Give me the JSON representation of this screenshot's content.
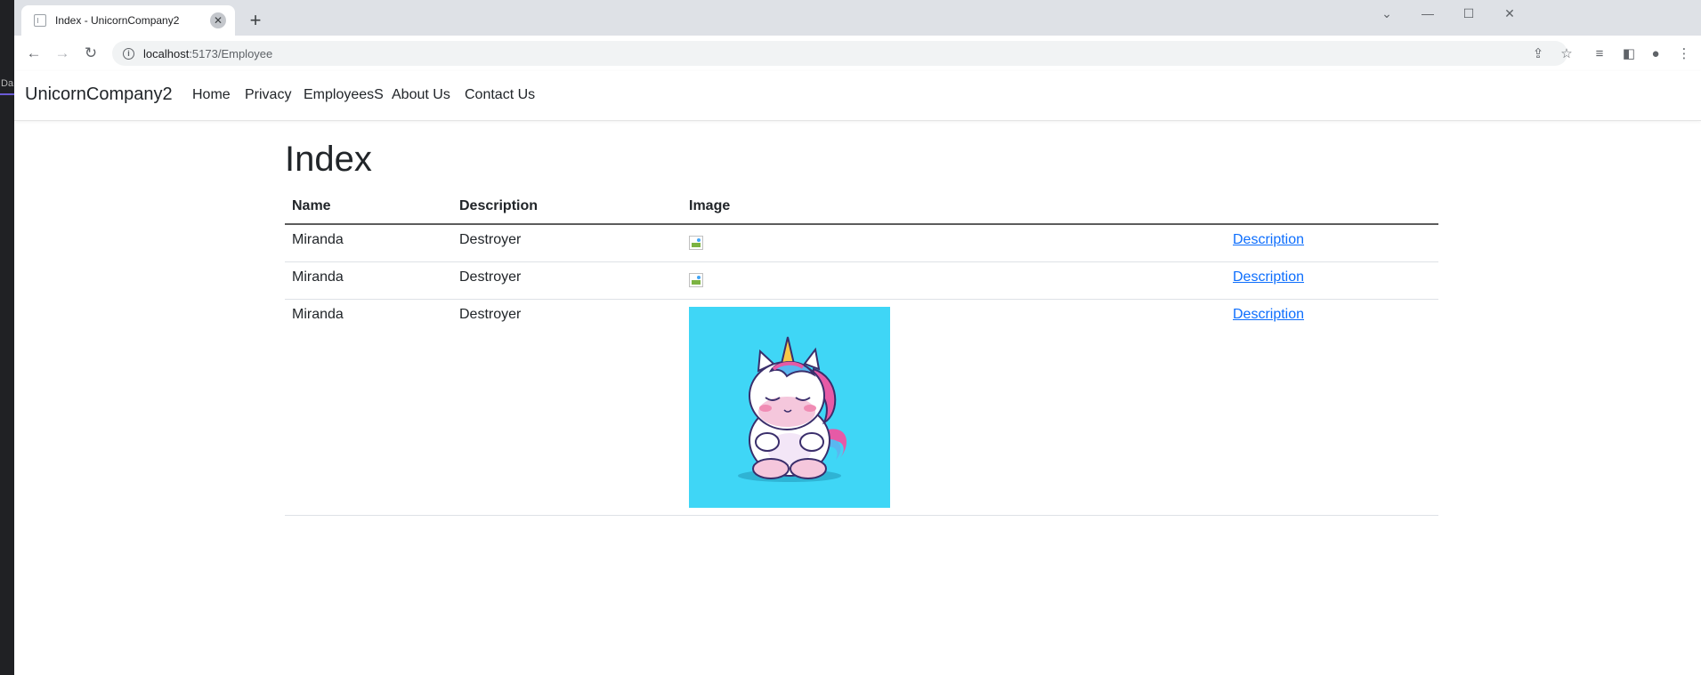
{
  "browser": {
    "tab_title": "Index - UnicornCompany2",
    "tab_close": "✕",
    "new_tab": "+",
    "url_host": "localhost",
    "url_path": ":5173/Employee",
    "left_strip_label": "Da"
  },
  "navbar": {
    "brand": "UnicornCompany2",
    "links": [
      "Home",
      "Privacy",
      "EmployeesS",
      "About Us",
      "Contact Us"
    ]
  },
  "page": {
    "title": "Index"
  },
  "table": {
    "columns": [
      "Name",
      "Description",
      "Image",
      ""
    ],
    "rows": [
      {
        "name": "Miranda",
        "description": "Destroyer",
        "image": "broken",
        "link": "Description"
      },
      {
        "name": "Miranda",
        "description": "Destroyer",
        "image": "broken",
        "link": "Description"
      },
      {
        "name": "Miranda",
        "description": "Destroyer",
        "image": "unicorn-illustration",
        "link": "Description"
      }
    ]
  },
  "colors": {
    "link": "#0d6efd",
    "image_background": "#3fd6f6",
    "tabstrip": "#dee1e6"
  }
}
